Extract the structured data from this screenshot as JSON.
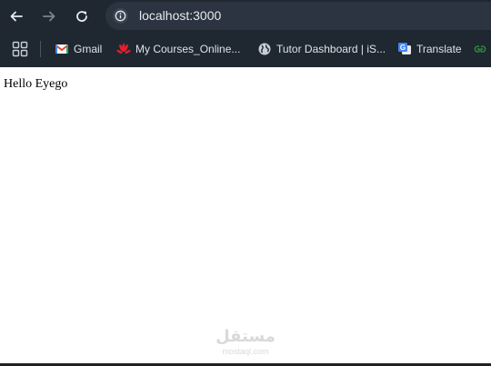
{
  "browser": {
    "address_bar": {
      "url": "localhost:3000"
    },
    "icons": {
      "back": "back-arrow-icon",
      "forward": "forward-arrow-icon",
      "reload": "reload-icon",
      "site_info": "info-icon"
    }
  },
  "bookmarks_bar": {
    "apps_icon": "apps-grid-icon",
    "items": [
      {
        "label": "Gmail",
        "icon": "gmail-icon"
      },
      {
        "label": "My Courses_Online...",
        "icon": "huawei-icon"
      },
      {
        "label": "Tutor Dashboard | iS...",
        "icon": "globe-icon"
      },
      {
        "label": "Translate",
        "icon": "google-translate-icon"
      },
      {
        "label": "",
        "icon": "geeksforgeeks-icon"
      }
    ]
  },
  "page": {
    "body_text": "Hello Eyego"
  },
  "watermark": {
    "main": "مستقل",
    "sub": "mostaql.com"
  },
  "colors": {
    "toolbar_bg": "#1f2731",
    "omnibox_bg": "#2b3440",
    "toolbar_text": "#e8eaed",
    "page_bg": "#ffffff"
  }
}
